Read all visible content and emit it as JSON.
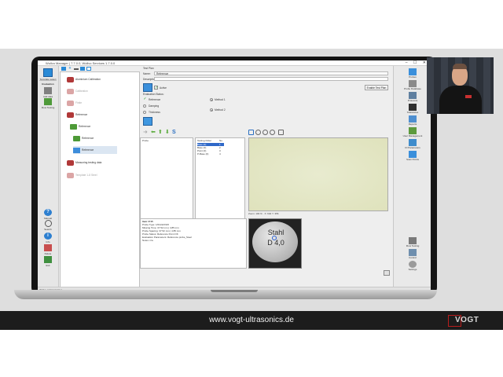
{
  "window": {
    "title": "Wollvo Manager | 7.7.0.0, Wollvo Services 1.7.0.0",
    "controls": "–  ☐  ✕"
  },
  "left_toolbar": {
    "items": [
      {
        "label": "Template select",
        "icon": "template-icon"
      },
      {
        "label": "Evaluation",
        "icon": "evaluation-icon"
      },
      {
        "label": "Add data",
        "icon": "add-data-icon"
      },
      {
        "label": "Flow Testing",
        "icon": "flow-testing-icon"
      },
      {
        "label": "Manual",
        "icon": "help-icon"
      },
      {
        "label": "Search",
        "icon": "search-icon"
      },
      {
        "label": "Info",
        "icon": "info-icon"
      },
      {
        "label": "Delete",
        "icon": "delete-icon"
      },
      {
        "label": "Exit",
        "icon": "exit-icon"
      }
    ]
  },
  "tree": {
    "items": [
      {
        "label": "Aluminium Calibration",
        "disabled": false,
        "color": "red"
      },
      {
        "label": "Calibration",
        "disabled": true,
        "color": "red"
      },
      {
        "label": "Finite",
        "disabled": true,
        "color": "red"
      },
      {
        "label": "Reference",
        "disabled": false,
        "color": "red"
      },
      {
        "label": "Reference",
        "disabled": false,
        "color": "green"
      },
      {
        "label": "Reference",
        "disabled": false,
        "color": "green"
      },
      {
        "label": "Reference",
        "disabled": false,
        "color": "blue",
        "selected": true
      },
      {
        "label": "Measuring testing data",
        "disabled": false,
        "color": "red"
      },
      {
        "label": "Template 1-8 Steel",
        "disabled": true,
        "color": "red"
      }
    ]
  },
  "form": {
    "header": "Test Plan",
    "name_label": "Name:",
    "name_value": "Reference",
    "description_label": "Description:",
    "description_value": "",
    "active_label": "Active",
    "add_button": "Enable Test Plan",
    "evaluation_label": "Evaluation Status:",
    "options": [
      {
        "label": "Reference",
        "checked": true
      },
      {
        "label": "Damping",
        "checked": false
      },
      {
        "label": "Thickness",
        "checked": false
      }
    ],
    "methods": [
      {
        "label": "Method 1",
        "checked": true
      },
      {
        "label": "Method 2",
        "checked": true
      }
    ]
  },
  "panes": {
    "left_header": "Probe",
    "mid_headers": [
      "Testing Order",
      "No."
    ],
    "mid_rows": [
      {
        "label": "Base (0)",
        "no": "1",
        "selected": true
      },
      {
        "label": "Base (0)",
        "no": "2",
        "selected": false
      },
      {
        "label": "Point (0)",
        "no": "3",
        "selected": false
      },
      {
        "label": "P-Base (0)",
        "no": "4",
        "selected": false
      }
    ]
  },
  "image": {
    "status": "Zoom: 100 %  ·  X: 640  Y: 356"
  },
  "info": {
    "lines": [
      "Item 1715",
      "Probe Type: 1/0/A/2/2/3/0",
      "Missing Time: 37.52 mm  |  4.85 mm",
      "Probe Spacing: 37.52 mm  |  4.85 mm",
      "Probe Status: Reference Point OK",
      "Evaluation Parameters: Reference probe_Steel",
      "Notes: n/a"
    ]
  },
  "sample": {
    "line1": "Stahl",
    "line2": "D 4,0"
  },
  "right_toolbar": {
    "items": [
      {
        "label": "Probes",
        "icon": "probes-icon"
      },
      {
        "label": "Probe Database",
        "icon": "database-icon"
      },
      {
        "label": "Protocols",
        "icon": "protocol-icon"
      },
      {
        "label": "Tolerances",
        "icon": "tolerance-icon"
      },
      {
        "label": "Reports",
        "icon": "reports-icon"
      },
      {
        "label": "User Management",
        "icon": "users-icon"
      },
      {
        "label": "IO Parameters",
        "icon": "io-icon"
      },
      {
        "label": "Scan Points",
        "icon": "scan-icon"
      },
      {
        "label": "Flow Testing",
        "icon": "flow-icon"
      },
      {
        "label": "Control",
        "icon": "control-icon"
      },
      {
        "label": "Settings",
        "icon": "settings-icon"
      }
    ]
  },
  "status_bar": {
    "text": "Wollvo | Administrator"
  },
  "footer": {
    "url": "www.vogt-ultrasonics.de",
    "brand": "VOGT"
  }
}
